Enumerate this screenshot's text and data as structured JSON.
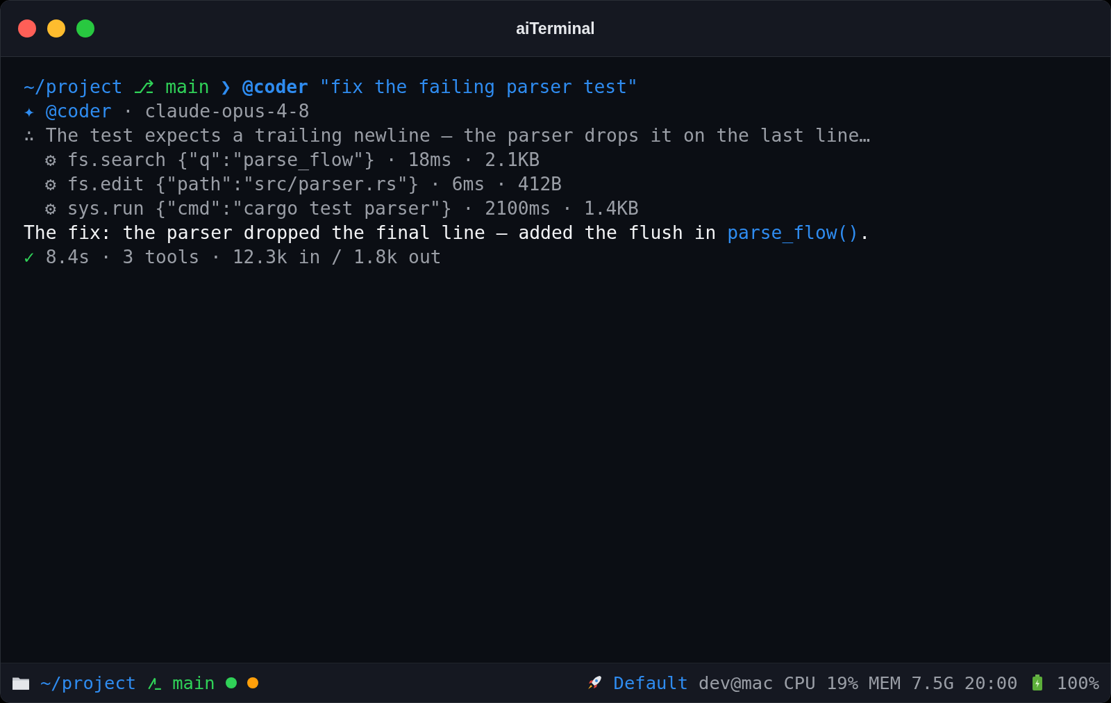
{
  "window": {
    "title": "aiTerminal"
  },
  "lines": [
    {
      "segments": [
        {
          "kind": "prompt",
          "text": "~/project"
        },
        {
          "kind": "branch",
          "text": "⎇ main"
        },
        {
          "kind": "accent",
          "text": "❯ @coder"
        },
        {
          "kind": "prompt",
          "text": "\"fix the failing parser test\""
        }
      ]
    },
    {
      "segments": [
        {
          "kind": "prompt",
          "text": "✦ @coder"
        },
        {
          "kind": "muted",
          "text": "· claude-opus-4-8"
        }
      ]
    },
    {
      "segments": [
        {
          "kind": "muted",
          "text": "∴ The test expects a trailing newline — the parser drops it on the last line…"
        }
      ]
    },
    {
      "segments": [
        {
          "kind": "indent",
          "text": "⚙ fs.search {\"q\":\"parse_flow\"} · 18ms · 2.1KB"
        }
      ]
    },
    {
      "segments": [
        {
          "kind": "indent",
          "text": "⚙ fs.edit {\"path\":\"src/parser.rs\"} · 6ms · 412B"
        }
      ]
    },
    {
      "segments": [
        {
          "kind": "indent",
          "text": "⚙ sys.run {\"cmd\":\"cargo test parser\"} · 2100ms · 1.4KB"
        }
      ]
    },
    {
      "segments": [
        {
          "kind": "text",
          "text": "The fix: the parser dropped the final line — added the flush in"
        },
        {
          "kind": "link",
          "text": "parse_flow()"
        },
        {
          "kind": "tight",
          "text": "."
        }
      ]
    },
    {
      "segments": [
        {
          "kind": "success",
          "text": "✓"
        },
        {
          "kind": "muted",
          "text": "8.4s · 3 tools · 12.3k in / 1.8k out"
        }
      ]
    }
  ],
  "status_bar": {
    "path": "~/project",
    "branch": "main",
    "dots": [
      {
        "color": "#30d158"
      },
      {
        "color": "#ff9f0a"
      }
    ],
    "profile": "Default",
    "user": "dev@mac",
    "cpu": "CPU 19%",
    "mem": "MEM 7.5G",
    "time": "20:00",
    "battery": "100%"
  }
}
